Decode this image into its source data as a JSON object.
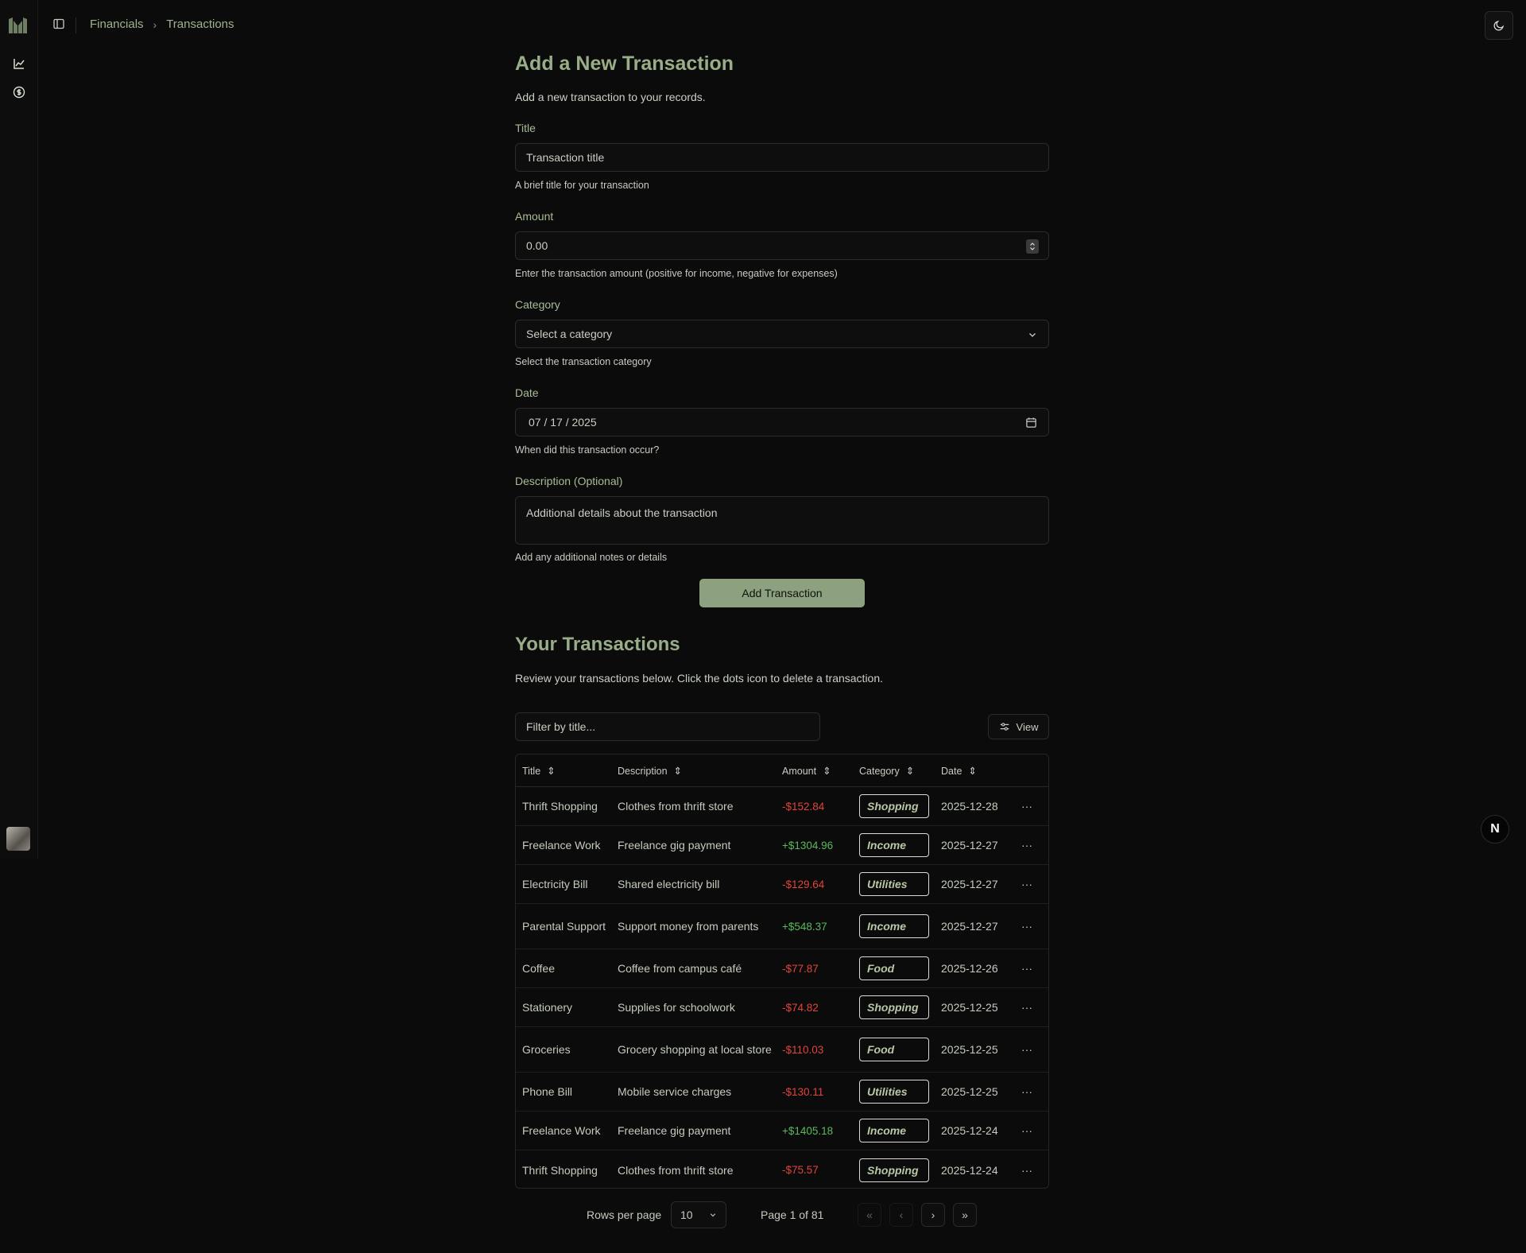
{
  "breadcrumb": {
    "items": [
      "Financials",
      "Transactions"
    ]
  },
  "form": {
    "heading": "Add a New Transaction",
    "subtitle": "Add a new transaction to your records.",
    "title_label": "Title",
    "title_placeholder": "Transaction title",
    "title_help": "A brief title for your transaction",
    "amount_label": "Amount",
    "amount_value": "0.00",
    "amount_help": "Enter the transaction amount (positive for income, negative for expenses)",
    "category_label": "Category",
    "category_placeholder": "Select a category",
    "category_help": "Select the transaction category",
    "date_label": "Date",
    "date_value": "07 / 17 / 2025",
    "date_help": "When did this transaction occur?",
    "description_label": "Description (Optional)",
    "description_placeholder": "Additional details about the transaction",
    "description_help": "Add any additional notes or details",
    "submit_label": "Add Transaction"
  },
  "transactions": {
    "heading": "Your Transactions",
    "subtitle": "Review your transactions below. Click the dots icon to delete a transaction.",
    "filter_placeholder": "Filter by title...",
    "view_label": "View",
    "columns": [
      "Title",
      "Description",
      "Amount",
      "Category",
      "Date"
    ],
    "rows": [
      {
        "title": "Thrift Shopping",
        "description": "Clothes from thrift store",
        "amount": "-$152.84",
        "sign": "neg",
        "category": "Shopping",
        "date": "2025-12-28"
      },
      {
        "title": "Freelance Work",
        "description": "Freelance gig payment",
        "amount": "+$1304.96",
        "sign": "pos",
        "category": "Income",
        "date": "2025-12-27"
      },
      {
        "title": "Electricity Bill",
        "description": "Shared electricity bill",
        "amount": "-$129.64",
        "sign": "neg",
        "category": "Utilities",
        "date": "2025-12-27"
      },
      {
        "title": "Parental Support",
        "description": "Support money from parents",
        "amount": "+$548.37",
        "sign": "pos",
        "category": "Income",
        "date": "2025-12-27"
      },
      {
        "title": "Coffee",
        "description": "Coffee from campus café",
        "amount": "-$77.87",
        "sign": "neg",
        "category": "Food",
        "date": "2025-12-26"
      },
      {
        "title": "Stationery",
        "description": "Supplies for schoolwork",
        "amount": "-$74.82",
        "sign": "neg",
        "category": "Shopping",
        "date": "2025-12-25"
      },
      {
        "title": "Groceries",
        "description": "Grocery shopping at local store",
        "amount": "-$110.03",
        "sign": "neg",
        "category": "Food",
        "date": "2025-12-25"
      },
      {
        "title": "Phone Bill",
        "description": "Mobile service charges",
        "amount": "-$130.11",
        "sign": "neg",
        "category": "Utilities",
        "date": "2025-12-25"
      },
      {
        "title": "Freelance Work",
        "description": "Freelance gig payment",
        "amount": "+$1405.18",
        "sign": "pos",
        "category": "Income",
        "date": "2025-12-24"
      },
      {
        "title": "Thrift Shopping",
        "description": "Clothes from thrift store",
        "amount": "-$75.57",
        "sign": "neg",
        "category": "Shopping",
        "date": "2025-12-24"
      }
    ],
    "rows_per_page_label": "Rows per page",
    "rows_per_page_value": "10",
    "page_info": "Page 1 of 81"
  },
  "badge_letter": "N",
  "icons": {
    "sidebar_toggle": "sidebar-toggle-icon",
    "chart": "chart-icon",
    "dollar": "dollar-circle-icon",
    "theme": "moon-icon",
    "calendar": "calendar-icon",
    "view": "sliders-icon"
  },
  "colors": {
    "accent": "#98ad88",
    "button": "#8da07f",
    "negative": "#e0443b",
    "positive": "#5bb85c"
  }
}
